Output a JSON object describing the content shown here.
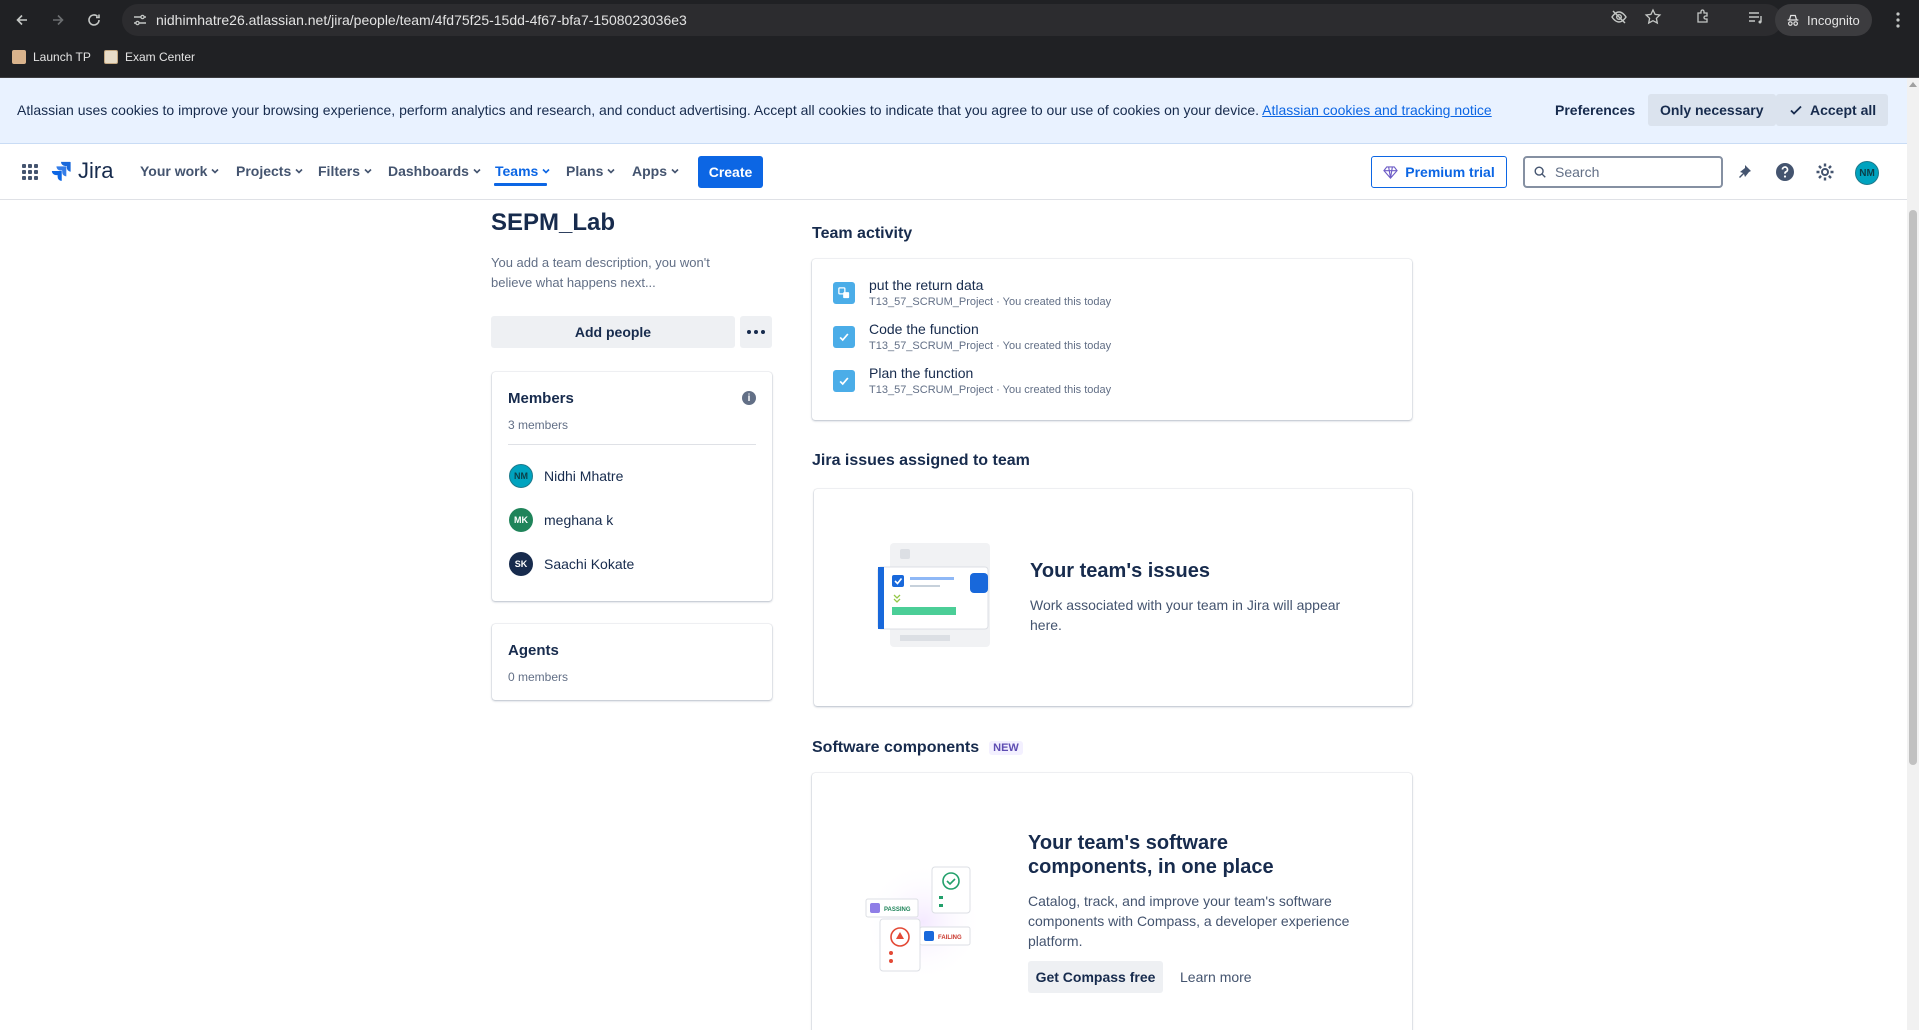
{
  "browser": {
    "url": "nidhimhatre26.atlassian.net/jira/people/team/4fd75f25-15dd-4f67-bfa7-1508023036e3",
    "incognito_label": "Incognito",
    "bookmarks": [
      {
        "label": "Launch TP"
      },
      {
        "label": "Exam Center"
      }
    ]
  },
  "cookie_banner": {
    "message": "Atlassian uses cookies to improve your browsing experience, perform analytics and research, and conduct advertising. Accept all cookies to indicate that you agree to our use of cookies on your device.",
    "link": "Atlassian cookies and tracking notice",
    "preferences": "Preferences",
    "only_necessary": "Only necessary",
    "accept_all": "Accept all"
  },
  "nav": {
    "logo": "Jira",
    "items": [
      {
        "label": "Your work"
      },
      {
        "label": "Projects"
      },
      {
        "label": "Filters"
      },
      {
        "label": "Dashboards"
      },
      {
        "label": "Teams"
      },
      {
        "label": "Plans"
      },
      {
        "label": "Apps"
      }
    ],
    "create": "Create",
    "premium": "Premium trial",
    "search_placeholder": "Search",
    "avatar": "NM"
  },
  "team": {
    "name": "SEPM_Lab",
    "description": "You add a team description, you won't believe what happens next...",
    "add_people": "Add people"
  },
  "members": {
    "title": "Members",
    "count": "3 members",
    "list": [
      {
        "initials": "NM",
        "name": "Nidhi Mhatre",
        "color": "#00a3bf"
      },
      {
        "initials": "MK",
        "name": "meghana k",
        "color": "#1f845a"
      },
      {
        "initials": "SK",
        "name": "Saachi Kokate",
        "color": "#172b4d"
      }
    ]
  },
  "agents": {
    "title": "Agents",
    "count": "0 members"
  },
  "activity": {
    "title": "Team activity",
    "items": [
      {
        "title": "put the return data",
        "meta": "T13_57_SCRUM_Project · You created this today",
        "icon": "subtask-icon"
      },
      {
        "title": "Code the function",
        "meta": "T13_57_SCRUM_Project · You created this today",
        "icon": "task-icon"
      },
      {
        "title": "Plan the function",
        "meta": "T13_57_SCRUM_Project · You created this today",
        "icon": "task-icon"
      }
    ]
  },
  "issues": {
    "title": "Jira issues assigned to team",
    "empty_title": "Your team's issues",
    "empty_body": "Work associated with your team in Jira will appear here."
  },
  "components": {
    "title": "Software components",
    "badge": "NEW",
    "empty_title": "Your team's software components, in one place",
    "empty_body": "Catalog, track, and improve your team's software components with Compass, a developer experience platform.",
    "primary_button": "Get Compass free",
    "secondary_button": "Learn more",
    "passing": "PASSING",
    "failing": "FAILING"
  }
}
